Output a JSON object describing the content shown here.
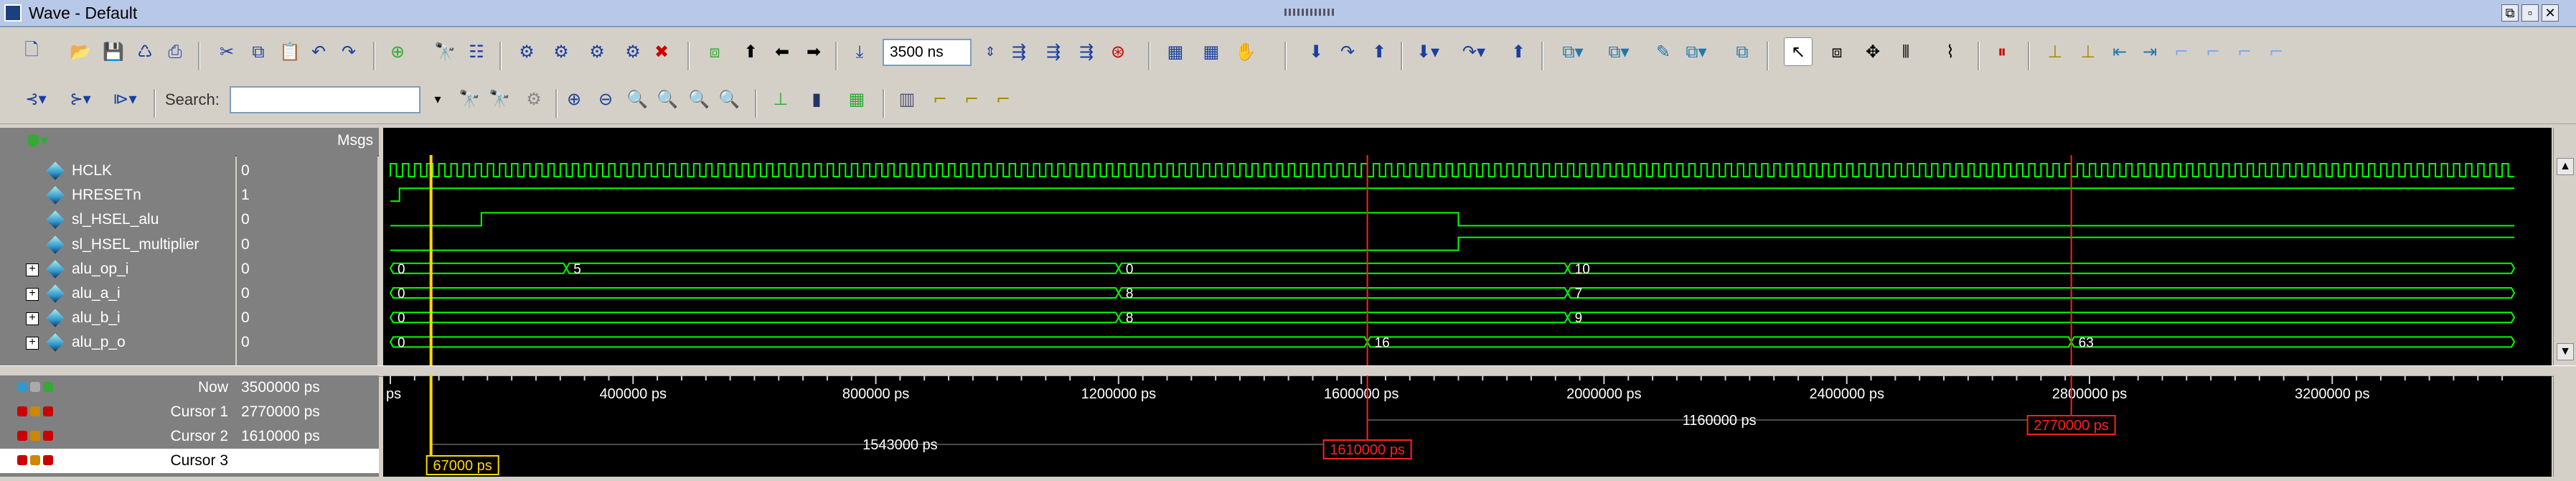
{
  "window": {
    "title": "Wave - Default"
  },
  "toolbar": {
    "run_length_value": "3500 ns",
    "search_label": "Search:",
    "search_placeholder": ""
  },
  "panel": {
    "msgs_header": "Msgs"
  },
  "signals": [
    {
      "name": "HCLK",
      "value": "0",
      "expandable": false
    },
    {
      "name": "HRESETn",
      "value": "1",
      "expandable": false
    },
    {
      "name": "sl_HSEL_alu",
      "value": "0",
      "expandable": false
    },
    {
      "name": "sl_HSEL_multiplier",
      "value": "0",
      "expandable": false
    },
    {
      "name": "alu_op_i",
      "value": "0",
      "expandable": true
    },
    {
      "name": "alu_a_i",
      "value": "0",
      "expandable": true
    },
    {
      "name": "alu_b_i",
      "value": "0",
      "expandable": true
    },
    {
      "name": "alu_p_o",
      "value": "0",
      "expandable": true
    }
  ],
  "buses": {
    "alu_op_i": [
      {
        "t": 0,
        "v": "0"
      },
      {
        "t": 290000,
        "v": "5"
      },
      {
        "t": 1200000,
        "v": "0"
      },
      {
        "t": 1940000,
        "v": "10"
      }
    ],
    "alu_a_i": [
      {
        "t": 0,
        "v": "0"
      },
      {
        "t": 1200000,
        "v": "8"
      },
      {
        "t": 1940000,
        "v": "7"
      }
    ],
    "alu_b_i": [
      {
        "t": 0,
        "v": "0"
      },
      {
        "t": 1200000,
        "v": "8"
      },
      {
        "t": 1940000,
        "v": "9"
      }
    ],
    "alu_p_o": [
      {
        "t": 0,
        "v": "0"
      },
      {
        "t": 1610000,
        "v": "16"
      },
      {
        "t": 2770000,
        "v": "63"
      }
    ]
  },
  "hsel_alu": {
    "rise": 150000,
    "fall": 1760000
  },
  "hresetn": {
    "rise": 15000
  },
  "cursors": [
    {
      "name": "Now",
      "value": "3500000 ps"
    },
    {
      "name": "Cursor 1",
      "value": "2770000 ps"
    },
    {
      "name": "Cursor 2",
      "value": "1610000 ps"
    },
    {
      "name": "Cursor 3",
      "value": "67000 ps"
    }
  ],
  "timeline": {
    "ticks": [
      "400000 ps",
      "800000 ps",
      "1200000 ps",
      "1600000 ps",
      "2000000 ps",
      "2400000 ps",
      "2800000 ps",
      "3200000 ps"
    ],
    "tick_values": [
      400000,
      800000,
      1200000,
      1600000,
      2000000,
      2400000,
      2800000,
      3200000
    ],
    "start_label": "ps",
    "delta_1": "1160000 ps",
    "delta_2": "1543000 ps",
    "cursor1_label": "2770000 ps",
    "cursor2_label": "1610000 ps",
    "cursor3_label": "67000 ps"
  },
  "colors": {
    "wave": "#00ff00",
    "bus_text": "#ffffff",
    "cursor_active": "#ffd800",
    "cursor_red": "#ff2020",
    "grid": "#555555"
  }
}
